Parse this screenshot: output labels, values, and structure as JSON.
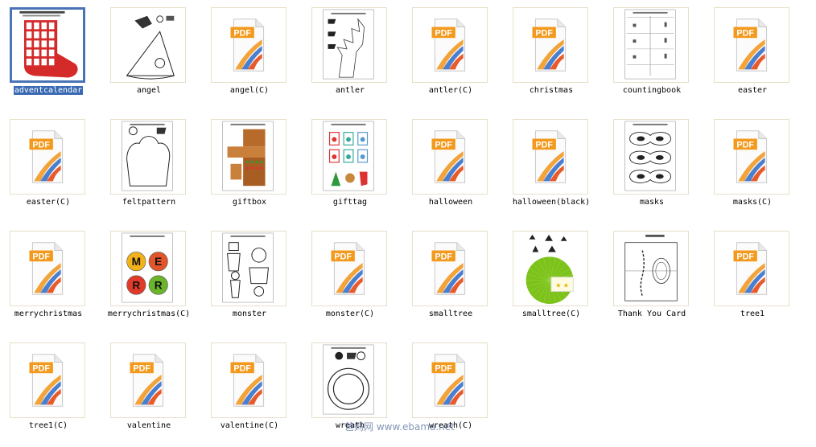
{
  "files": [
    {
      "name": "adventcalendar",
      "kind": "stocking",
      "selected": true
    },
    {
      "name": "angel",
      "kind": "angel"
    },
    {
      "name": "angel(C)",
      "kind": "pdf",
      "badge": "PDF"
    },
    {
      "name": "antler",
      "kind": "antler"
    },
    {
      "name": "antler(C)",
      "kind": "pdf",
      "badge": "PDF"
    },
    {
      "name": "christmas",
      "kind": "pdf",
      "badge": "PDF"
    },
    {
      "name": "countingbook",
      "kind": "countingbook"
    },
    {
      "name": "easter",
      "kind": "pdf",
      "badge": "PDF"
    },
    {
      "name": "easter(C)",
      "kind": "pdf",
      "badge": "PDF"
    },
    {
      "name": "feltpattern",
      "kind": "felt"
    },
    {
      "name": "giftbox",
      "kind": "giftbox"
    },
    {
      "name": "gifttag",
      "kind": "gifttag"
    },
    {
      "name": "halloween",
      "kind": "pdf",
      "badge": "PDF"
    },
    {
      "name": "halloween(black)",
      "kind": "pdf",
      "badge": "PDF"
    },
    {
      "name": "masks",
      "kind": "masks"
    },
    {
      "name": "masks(C)",
      "kind": "pdf",
      "badge": "PDF"
    },
    {
      "name": "merrychristmas",
      "kind": "pdf",
      "badge": "PDF"
    },
    {
      "name": "merrychristmas(C)",
      "kind": "merry",
      "letters": [
        "M",
        "E",
        "R",
        "R"
      ]
    },
    {
      "name": "monster",
      "kind": "monster"
    },
    {
      "name": "monster(C)",
      "kind": "pdf",
      "badge": "PDF"
    },
    {
      "name": "smalltree",
      "kind": "pdf",
      "badge": "PDF"
    },
    {
      "name": "smalltree(C)",
      "kind": "smalltree"
    },
    {
      "name": "Thank You Card",
      "kind": "thankyou"
    },
    {
      "name": "tree1",
      "kind": "pdf",
      "badge": "PDF"
    },
    {
      "name": "tree1(C)",
      "kind": "pdf",
      "badge": "PDF"
    },
    {
      "name": "valentine",
      "kind": "pdf",
      "badge": "PDF"
    },
    {
      "name": "valentine(C)",
      "kind": "pdf",
      "badge": "PDF"
    },
    {
      "name": "wreath",
      "kind": "wreath"
    },
    {
      "name": "wreath(C)",
      "kind": "pdf",
      "badge": "PDF"
    }
  ],
  "watermark": "爸妈网  www.ebama.net",
  "colors": {
    "selection": "#3a69b3",
    "thumb_border": "#e6dfc8",
    "pdf_badge": "#f39a1e",
    "stocking": "#d42a2a",
    "tree_green": "#7cc21a"
  }
}
